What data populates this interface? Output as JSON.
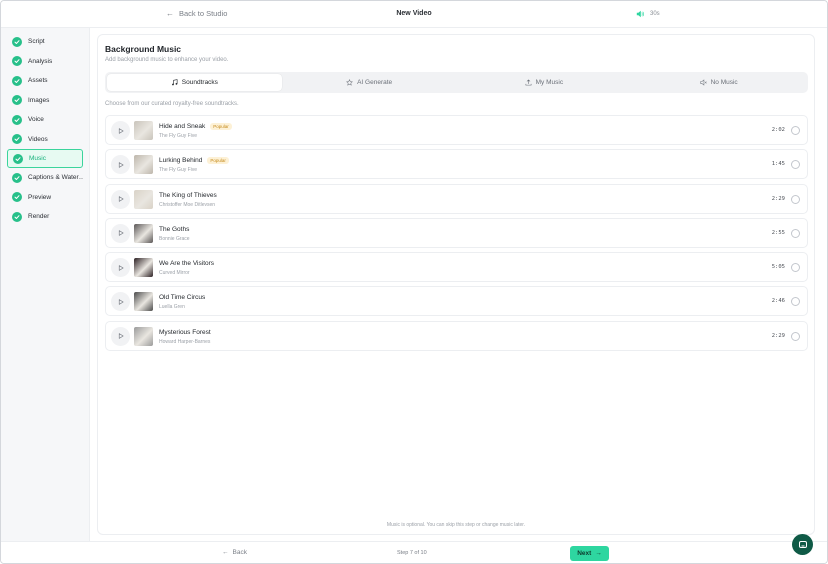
{
  "topbar": {
    "back_label": "Back to Studio",
    "title": "New Video",
    "duration": "30s"
  },
  "sidebar": {
    "items": [
      {
        "label": "Script"
      },
      {
        "label": "Analysis"
      },
      {
        "label": "Assets"
      },
      {
        "label": "Images"
      },
      {
        "label": "Voice"
      },
      {
        "label": "Videos"
      },
      {
        "label": "Music",
        "active": true
      },
      {
        "label": "Captions & Water…"
      },
      {
        "label": "Preview"
      },
      {
        "label": "Render"
      }
    ]
  },
  "main": {
    "title": "Background Music",
    "subtitle": "Add background music to enhance your video.",
    "tabs": [
      {
        "label": "Soundtracks",
        "icon": "music-note-icon",
        "active": true
      },
      {
        "label": "AI Generate",
        "icon": "sparkle-star-icon"
      },
      {
        "label": "My Music",
        "icon": "upload-icon"
      },
      {
        "label": "No Music",
        "icon": "volume-mute-icon"
      }
    ],
    "hint": "Choose from our curated royalty-free soundtracks.",
    "tracks": [
      {
        "title": "Hide and Sneak",
        "artist": "The Fly Guy Five",
        "badge": "Popular",
        "duration": "2:02",
        "cover_color": "#c9c4bb"
      },
      {
        "title": "Lurking Behind",
        "artist": "The Fly Guy Five",
        "badge": "Popular",
        "duration": "1:45",
        "cover_color": "#bdb6ab"
      },
      {
        "title": "The King of Thieves",
        "artist": "Christoffer Moe Ditlevsen",
        "badge": "",
        "duration": "2:29",
        "cover_color": "#d9d2c7"
      },
      {
        "title": "The Goths",
        "artist": "Bonnie Grace",
        "badge": "",
        "duration": "2:55",
        "cover_color": "#5a5656"
      },
      {
        "title": "We Are the Visitors",
        "artist": "Curved Mirror",
        "badge": "",
        "duration": "5:05",
        "cover_color": "#2b1f22"
      },
      {
        "title": "Old Time Circus",
        "artist": "Luella Gren",
        "badge": "",
        "duration": "2:46",
        "cover_color": "#4a4a4a"
      },
      {
        "title": "Mysterious Forest",
        "artist": "Howard Harper-Barnes",
        "badge": "",
        "duration": "2:29",
        "cover_color": "#9a9a9a"
      }
    ],
    "footnote": "Music is optional. You can skip this step or change music later."
  },
  "bottombar": {
    "back_label": "Back",
    "step_text": "Step 7 of 10",
    "next_label": "Next"
  },
  "colors": {
    "accent": "#2ed6a0",
    "check": "#27c08a",
    "active_bg": "#e7faf2"
  }
}
